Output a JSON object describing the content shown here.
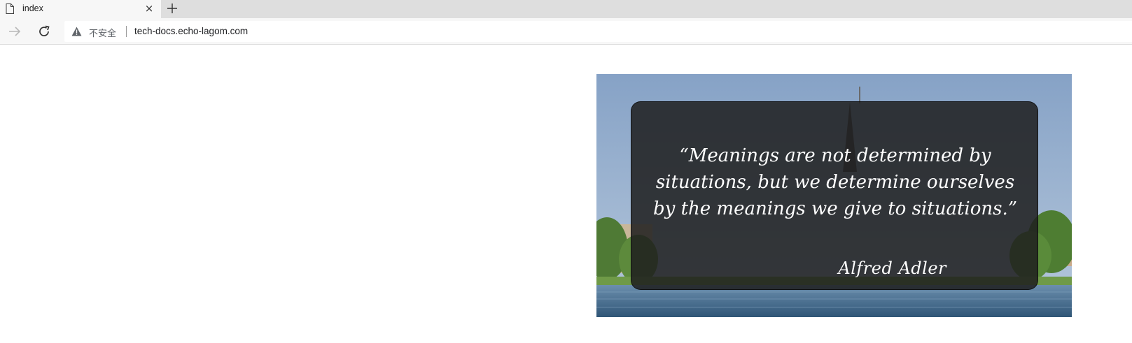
{
  "browser": {
    "tab": {
      "title": "index",
      "close_glyph": "×",
      "icon": "document-icon"
    },
    "new_tab_icon": "plus-icon",
    "nav": {
      "forward_icon": "arrow-right-icon",
      "reload_icon": "reload-icon"
    },
    "omnibox": {
      "security_icon": "warning-triangle-icon",
      "security_label": "不安全",
      "url": "tech-docs.echo-lagom.com"
    }
  },
  "page": {
    "hero": {
      "background": "lake-town-church-photo",
      "quote": "“Meanings are not determined by situations, but we determine ourselves by the meanings we give to situations.”",
      "author": "Alfred Adler"
    }
  },
  "colors": {
    "card_background": "#1e1e1e",
    "sky": "#8aa6c9",
    "water": "#4a6f8f"
  }
}
